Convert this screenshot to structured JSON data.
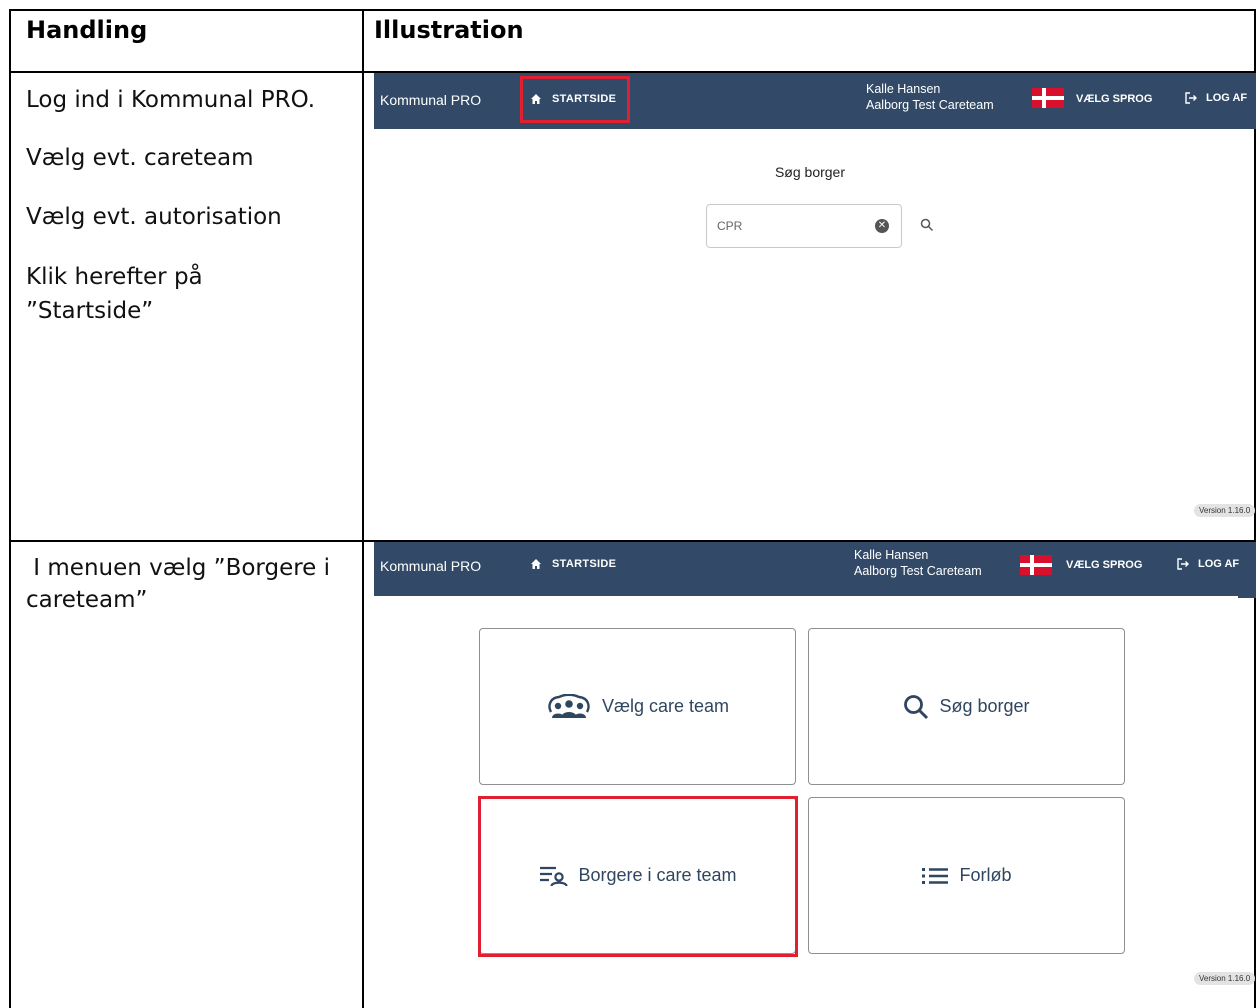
{
  "table": {
    "col1_header": "Handling",
    "col2_header": "Illustration"
  },
  "rows": [
    {
      "steps": [
        "Log ind i Kommunal PRO.",
        "Vælg evt. careteam",
        "Vælg evt. autorisation",
        "Klik herefter på",
        "”Startside”"
      ]
    },
    {
      "steps": [
        " I menuen vælg ”Borgere i",
        "careteam”"
      ]
    }
  ],
  "app": {
    "brand": "Kommunal PRO",
    "home_label": "STARTSIDE",
    "user_name": "Kalle Hansen",
    "user_team": "Aalborg Test Careteam",
    "language_label": "VÆLG SPROG",
    "logout_label": "LOG AF",
    "version": "Version 1.16.0",
    "colors": {
      "appbar": "#324a67",
      "highlight": "#e02030",
      "tile_text": "#2f4660"
    }
  },
  "screen1": {
    "search_title": "Søg borger",
    "search_placeholder": "CPR"
  },
  "screen2": {
    "tiles": [
      {
        "label": "Vælg care team",
        "icon": "people-group-icon"
      },
      {
        "label": "Søg borger",
        "icon": "search-icon"
      },
      {
        "label": "Borgere i care team",
        "icon": "person-list-icon"
      },
      {
        "label": "Forløb",
        "icon": "list-icon"
      }
    ]
  }
}
